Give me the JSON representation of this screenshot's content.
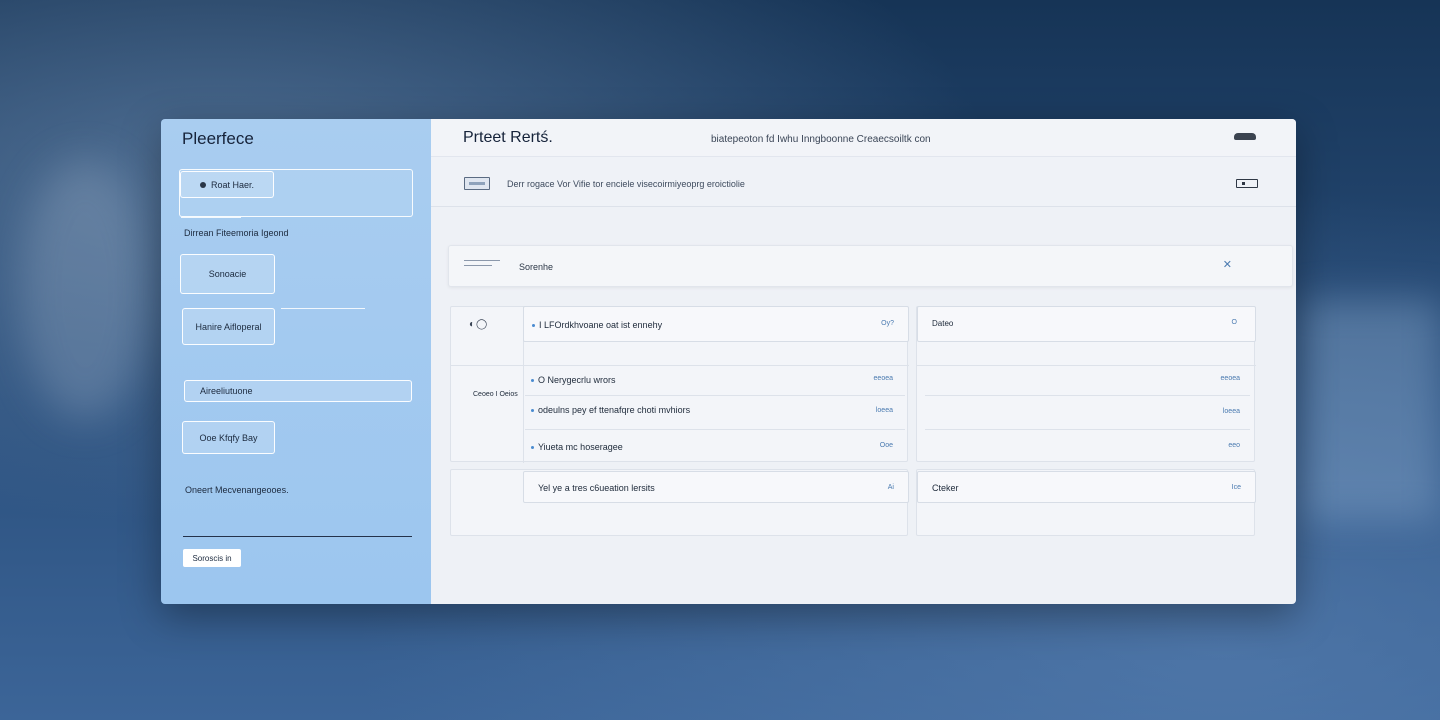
{
  "sidebar": {
    "title": "Pleerfece",
    "button_primary": "Roat Haer.",
    "section_label": "Dirrean Fiteemoria Igeond",
    "button_secondary": "Sonoacie",
    "button_third": "Hanire Aifloperal",
    "input_value": "Aireeliutuone",
    "button_fourth": "Ooe Kfqfy Bay",
    "section_label_2": "Oneert Mecvenangeooes.",
    "chip": "Soroscis in"
  },
  "header": {
    "title": "Prteet Rertś.",
    "url": "biatepeoton fd Iwhu Inngboonne Creaecsoiltk con"
  },
  "subbar": {
    "text": "Derr rogace Vor Vifie tor enciele visecoirmiyeoprg eroictiolie"
  },
  "search": {
    "label": "Sorenhe",
    "close": "✕"
  },
  "panel_left": {
    "header_row": "I LFOrdkhvoane oat ist ennehy",
    "header_meta": "Oy?",
    "side_label": "Ceoeo I Oeios",
    "rows": [
      {
        "text": "O Nerygecrlu wrors",
        "meta": "eeoea"
      },
      {
        "text": "odeulns pey ef ttenafqre choti mvhiors",
        "meta": "loeea"
      },
      {
        "text": "Yiueta mc hoseragee",
        "meta": "Ooe"
      }
    ],
    "footer_row": "Yel ye a tres c6ueation lersits",
    "footer_meta": "Ai"
  },
  "panel_right": {
    "header_row": "Dateo",
    "header_meta": "O",
    "rows": [
      {
        "meta": "eeoea"
      },
      {
        "meta": "loeea"
      },
      {
        "meta": "eeo"
      }
    ],
    "footer_row": "Cteker",
    "footer_meta": "Ice"
  }
}
